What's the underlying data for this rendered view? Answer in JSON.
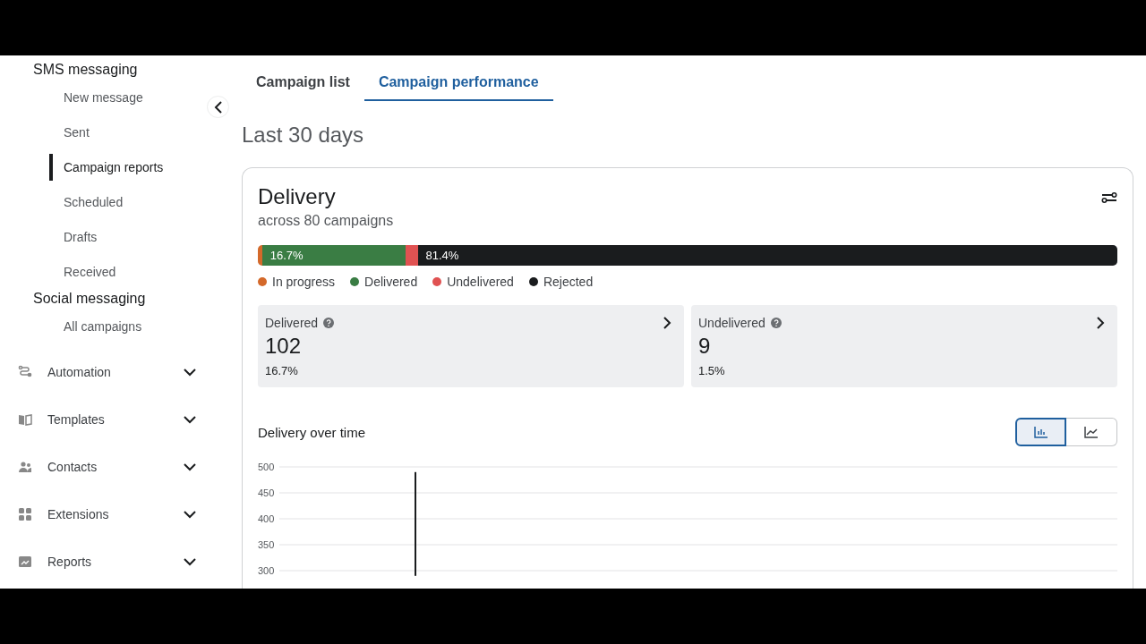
{
  "sidebar": {
    "groups": [
      {
        "title": "SMS messaging",
        "items": [
          {
            "label": "New message",
            "selected": false
          },
          {
            "label": "Sent",
            "selected": false
          },
          {
            "label": "Campaign reports",
            "selected": true
          },
          {
            "label": "Scheduled",
            "selected": false
          },
          {
            "label": "Drafts",
            "selected": false
          },
          {
            "label": "Received",
            "selected": false
          }
        ]
      },
      {
        "title": "Social messaging",
        "items": [
          {
            "label": "All campaigns",
            "selected": false
          }
        ]
      }
    ],
    "sections": [
      {
        "label": "Automation",
        "kind": "automation",
        "expanded": false
      },
      {
        "label": "Templates",
        "kind": "templates",
        "expanded": false
      },
      {
        "label": "Contacts",
        "kind": "contacts",
        "expanded": false
      },
      {
        "label": "Extensions",
        "kind": "extensions",
        "expanded": false
      },
      {
        "label": "Reports",
        "kind": "reports",
        "expanded": false
      }
    ]
  },
  "tabs": [
    {
      "label": "Campaign list",
      "selected": false
    },
    {
      "label": "Campaign performance",
      "selected": true
    }
  ],
  "period": "Last 30 days",
  "delivery": {
    "title": "Delivery",
    "subtitle": "across 80 campaigns",
    "segments": [
      {
        "name": "In progress",
        "color": "#d4692a",
        "level": 0.005
      },
      {
        "name": "Delivered",
        "color": "#3a7d44",
        "level": 0.167,
        "reading": "16.7%"
      },
      {
        "name": "Undelivered",
        "color": "#e05252",
        "level": 0.014
      },
      {
        "name": "Rejected",
        "color": "#1a1c1e",
        "level": 0.814,
        "reading": "81.4%"
      }
    ],
    "stats": [
      {
        "label": "Delivered",
        "value": "102",
        "percent": "16.7%"
      },
      {
        "label": "Undelivered",
        "value": "9",
        "percent": "1.5%"
      }
    ]
  },
  "over_time": {
    "title": "Delivery over time",
    "views": [
      {
        "kind": "bar",
        "selected": true
      },
      {
        "kind": "line",
        "selected": false
      }
    ],
    "chart_data": {
      "type": "bar",
      "grid": true,
      "ylim": [
        290,
        500
      ],
      "yticks": [
        300,
        350,
        400,
        450,
        500
      ],
      "series": [
        {
          "color": "#1a1c1e",
          "values": [
            490
          ]
        }
      ]
    }
  }
}
